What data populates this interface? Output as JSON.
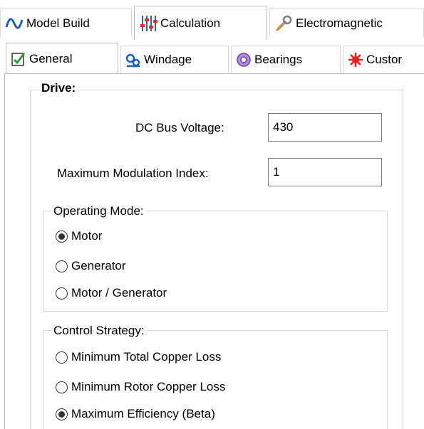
{
  "top_tabs": [
    {
      "label": "Model Build",
      "icon": "waveform-icon",
      "active": false
    },
    {
      "label": "Calculation",
      "icon": "sliders-icon",
      "active": true
    },
    {
      "label": "Electromagnetic",
      "icon": "wrench-icon",
      "active": false
    }
  ],
  "sub_tabs": [
    {
      "label": "General",
      "icon": "notepad-check-icon",
      "active": true
    },
    {
      "label": "Windage",
      "icon": "fan-icon",
      "active": false
    },
    {
      "label": "Bearings",
      "icon": "bearing-icon",
      "active": false
    },
    {
      "label": "Custor",
      "icon": "starburst-icon",
      "active": false
    }
  ],
  "drive": {
    "title": "Drive:",
    "dc_bus_voltage": {
      "label": "DC Bus Voltage:",
      "value": "430"
    },
    "max_modulation_index": {
      "label": "Maximum Modulation Index:",
      "value": "1"
    },
    "operating_mode": {
      "title": "Operating Mode:",
      "options": [
        "Motor",
        "Generator",
        "Motor / Generator"
      ],
      "selected": "Motor"
    },
    "control_strategy": {
      "title": "Control Strategy:",
      "options": [
        "Minimum Total Copper Loss",
        "Minimum Rotor Copper Loss",
        "Maximum Efficiency (Beta)"
      ],
      "selected": "Maximum Efficiency (Beta)"
    }
  },
  "colors": {
    "accent_blue": "#1a5fb4",
    "sliders_blue": "#2b62c9",
    "burst_red": "#e8201c"
  }
}
